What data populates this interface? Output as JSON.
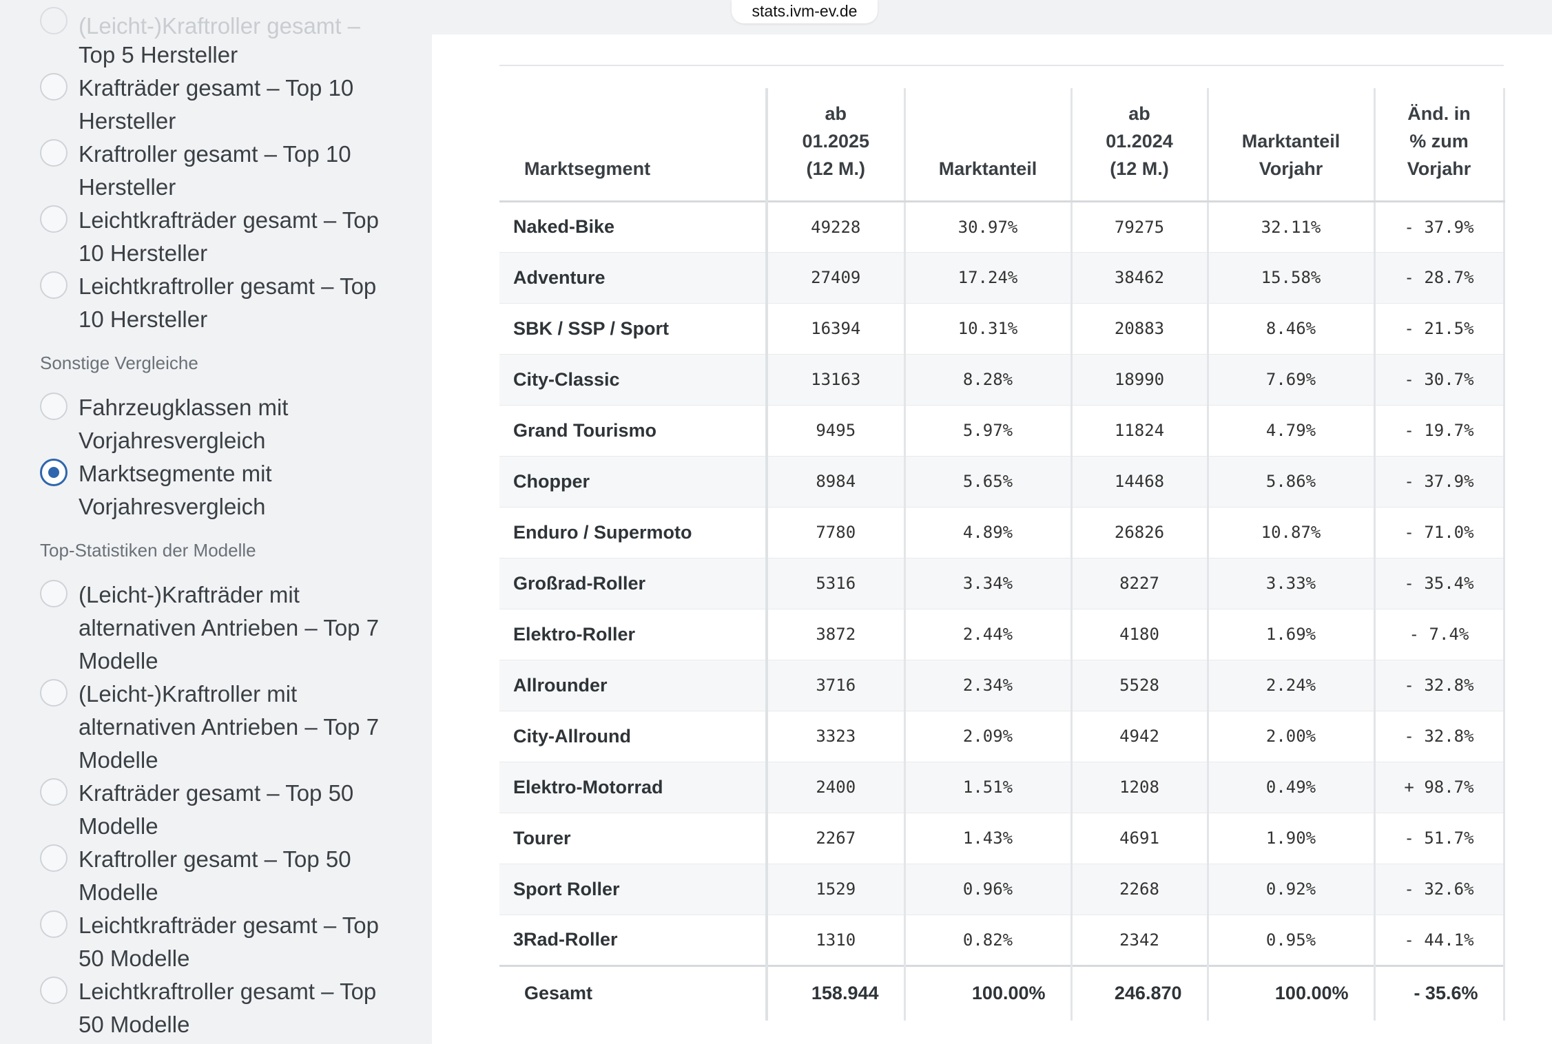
{
  "browser": {
    "url": "stats.ivm-ev.de"
  },
  "sidebar": {
    "partial_item": "(Leicht-)Kraftroller gesamt –",
    "items_top": [
      {
        "label": "Top 5 Hersteller",
        "checked": false
      },
      {
        "label": "Krafträder gesamt – Top 10 Hersteller",
        "checked": false
      },
      {
        "label": "Kraftroller gesamt – Top 10 Hersteller",
        "checked": false
      },
      {
        "label": "Leichtkrafträder gesamt – Top 10 Hersteller",
        "checked": false
      },
      {
        "label": "Leichtkraftroller gesamt – Top 10 Hersteller",
        "checked": false
      }
    ],
    "group_other": "Sonstige Vergleiche",
    "items_other": [
      {
        "label": "Fahrzeugklassen mit Vorjahresvergleich",
        "checked": false
      },
      {
        "label": "Marktsegmente mit Vorjahresvergleich",
        "checked": true
      }
    ],
    "group_models": "Top-Statistiken der Modelle",
    "items_models": [
      {
        "label": "(Leicht-)Krafträder mit alternativen Antrieben – Top 7 Modelle",
        "checked": false
      },
      {
        "label": "(Leicht-)Kraftroller mit alternativen Antrieben – Top 7 Modelle",
        "checked": false
      },
      {
        "label": "Krafträder gesamt – Top 50 Modelle",
        "checked": false
      },
      {
        "label": "Kraftroller gesamt – Top 50 Modelle",
        "checked": false
      },
      {
        "label": "Leichtkrafträder gesamt – Top 50 Modelle",
        "checked": false
      },
      {
        "label": "Leichtkraftroller gesamt – Top 50 Modelle",
        "checked": false
      }
    ]
  },
  "table": {
    "headers": {
      "segment": "Marktsegment",
      "current_line1": "ab",
      "current_line2": "01.2025",
      "current_line3": "(12 M.)",
      "share": "Marktanteil",
      "previous_line1": "ab",
      "previous_line2": "01.2024",
      "previous_line3": "(12 M.)",
      "share_prev_line1": "Marktanteil",
      "share_prev_line2": "Vorjahr",
      "change_line1": "Änd. in",
      "change_line2": "% zum",
      "change_line3": "Vorjahr"
    },
    "rows": [
      [
        "Naked-Bike",
        "49228",
        "30.97%",
        "79275",
        "32.11%",
        "- 37.9%"
      ],
      [
        "Adventure",
        "27409",
        "17.24%",
        "38462",
        "15.58%",
        "- 28.7%"
      ],
      [
        "SBK / SSP / Sport",
        "16394",
        "10.31%",
        "20883",
        "8.46%",
        "- 21.5%"
      ],
      [
        "City-Classic",
        "13163",
        "8.28%",
        "18990",
        "7.69%",
        "- 30.7%"
      ],
      [
        "Grand Tourismo",
        "9495",
        "5.97%",
        "11824",
        "4.79%",
        "- 19.7%"
      ],
      [
        "Chopper",
        "8984",
        "5.65%",
        "14468",
        "5.86%",
        "- 37.9%"
      ],
      [
        "Enduro / Supermoto",
        "7780",
        "4.89%",
        "26826",
        "10.87%",
        "- 71.0%"
      ],
      [
        "Großrad-Roller",
        "5316",
        "3.34%",
        "8227",
        "3.33%",
        "- 35.4%"
      ],
      [
        "Elektro-Roller",
        "3872",
        "2.44%",
        "4180",
        "1.69%",
        "- 7.4%"
      ],
      [
        "Allrounder",
        "3716",
        "2.34%",
        "5528",
        "2.24%",
        "- 32.8%"
      ],
      [
        "City-Allround",
        "3323",
        "2.09%",
        "4942",
        "2.00%",
        "- 32.8%"
      ],
      [
        "Elektro-Motorrad",
        "2400",
        "1.51%",
        "1208",
        "0.49%",
        "+ 98.7%"
      ],
      [
        "Tourer",
        "2267",
        "1.43%",
        "4691",
        "1.90%",
        "- 51.7%"
      ],
      [
        "Sport Roller",
        "1529",
        "0.96%",
        "2268",
        "0.92%",
        "- 32.6%"
      ],
      [
        "3Rad-Roller",
        "1310",
        "0.82%",
        "2342",
        "0.95%",
        "- 44.1%"
      ]
    ],
    "total": [
      "Gesamt",
      "158.944",
      "100.00%",
      "246.870",
      "100.00%",
      "- 35.6%"
    ]
  }
}
